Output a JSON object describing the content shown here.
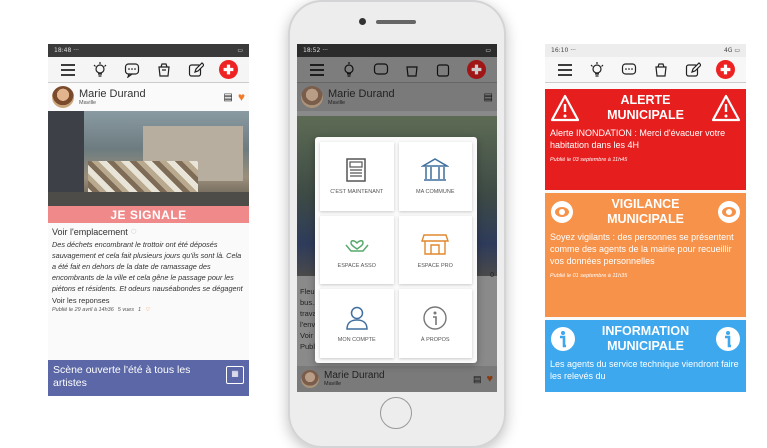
{
  "left": {
    "status": {
      "time": "18:48",
      "dots": "···",
      "signal": "⁵ᴳ.ıl"
    },
    "author": {
      "name": "Marie Durand",
      "sub": "Maville"
    },
    "signal_banner": "JE SIGNALE",
    "location_link": "Voir l'emplacement",
    "body": "Des déchets encombrant le trottoir ont été déposés sauvagement et cela fait plusieurs jours qu'ils sont là. Cela a été fait en dehors de la date de ramassage des encombrants de la ville et cela gêne le passage pour les piétons et résidents. Et odeurs nauséabondes se dégagent",
    "replies_link": "Voir les reponses",
    "meta": "Publié le 29 avril à 14h36",
    "views": "5 vues",
    "likes": "1",
    "event": "Scène ouverte l'été à tous les artistes"
  },
  "middle": {
    "status": {
      "time": "18:52",
      "dots": "···",
      "signal": ".ıl"
    },
    "author": {
      "name": "Marie Durand",
      "sub": "Maville"
    },
    "bg_text": [
      "Fleur",
      "bus...",
      "trava",
      "l'env",
      "Voir",
      "Publi"
    ],
    "side_count": "0",
    "menu": [
      {
        "label": "C'EST MAINTENANT",
        "icon": "newspaper-icon"
      },
      {
        "label": "MA COMMUNE",
        "icon": "town-hall-icon"
      },
      {
        "label": "ESPACE ASSO",
        "icon": "hands-heart-icon"
      },
      {
        "label": "ESPACE PRO",
        "icon": "shop-icon"
      },
      {
        "label": "MON COMPTE",
        "icon": "user-icon"
      },
      {
        "label": "À PROPOS",
        "icon": "info-icon"
      }
    ],
    "bottom_author": {
      "name": "Marie Durand",
      "sub": "Maville"
    }
  },
  "right": {
    "status": {
      "time": "16:10",
      "dots": "···",
      "signal": "4G"
    },
    "alerts": [
      {
        "title1": "ALERTE",
        "title2": "MUNICIPALE",
        "body": "Alerte INONDATION : Merci d'évacuer votre habitation dans les 4H",
        "meta": "Publié le 03 septembre à 11h45",
        "color": "#e61e1e",
        "icon": "warning-icon"
      },
      {
        "title1": "VIGILANCE",
        "title2": "MUNICIPALE",
        "body": "Soyez vigilants : des personnes se présentent comme des agents de la mairie pour recueillir vos données personnelles",
        "meta": "Publié le 01 septembre à 11h35",
        "color": "#f7924a",
        "icon": "eye-icon"
      },
      {
        "title1": "INFORMATION",
        "title2": "MUNICIPALE",
        "body": "Les agents du service technique viendront faire les relevés du",
        "meta": "",
        "color": "#3ea8ee",
        "icon": "info-icon"
      }
    ]
  }
}
